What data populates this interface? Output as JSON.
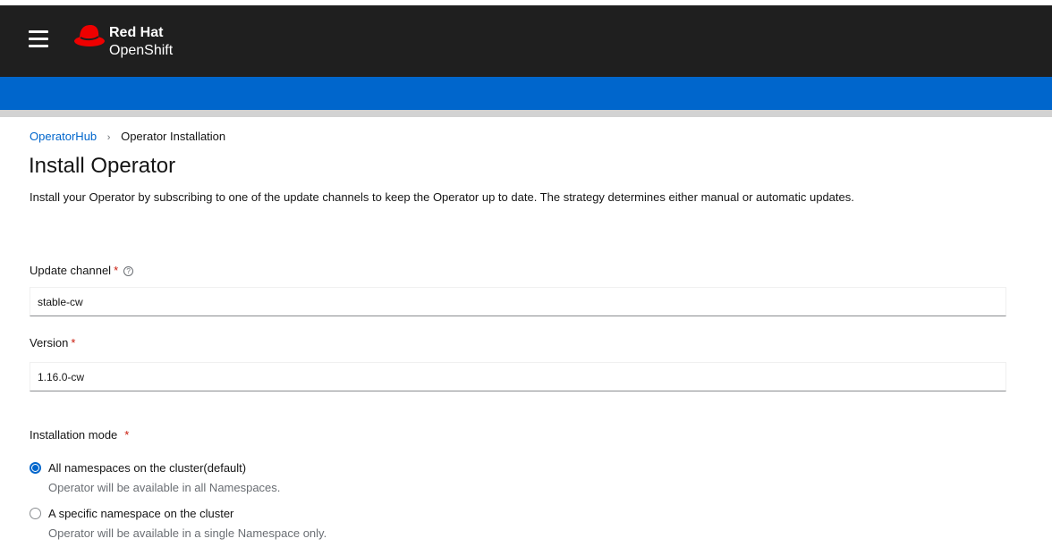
{
  "header": {
    "brand_line1": "Red Hat",
    "brand_line2": "OpenShift"
  },
  "breadcrumb": {
    "link": "OperatorHub",
    "separator": "›",
    "current": "Operator Installation"
  },
  "page": {
    "title": "Install Operator",
    "description": "Install your Operator by subscribing to one of the update channels to keep the Operator up to date. The strategy determines either manual or automatic updates."
  },
  "form": {
    "update_channel": {
      "label": "Update channel",
      "required": "*",
      "help_icon": "question-circle-icon",
      "value": "stable-cw"
    },
    "version": {
      "label": "Version",
      "required": "*",
      "value": "1.16.0-cw"
    },
    "installation_mode": {
      "label": "Installation mode",
      "required": "*",
      "options": [
        {
          "label": "All namespaces on the cluster(default)",
          "help": "Operator will be available in all Namespaces.",
          "selected": true
        },
        {
          "label": "A specific namespace on the cluster",
          "help": "Operator will be available in a single Namespace only.",
          "selected": false
        }
      ]
    }
  },
  "colors": {
    "masthead": "#1f1f1f",
    "blue_bar": "#0066cc",
    "link": "#0066cc",
    "required": "#c9190b",
    "logo_red": "#ee0000"
  }
}
